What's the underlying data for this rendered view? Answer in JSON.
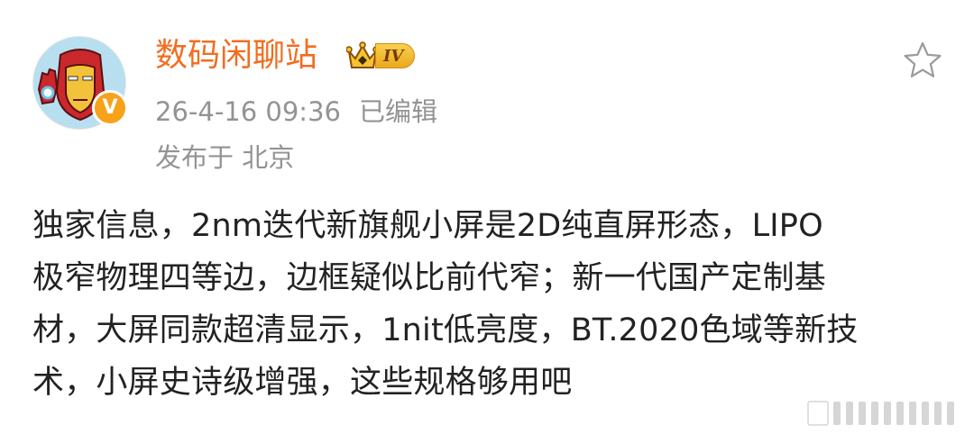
{
  "post": {
    "username": "数码闲聊站",
    "vip_level": "IV",
    "timestamp": "26-4-16 09:36",
    "edited_label": "已编辑",
    "location": "发布于 北京",
    "verified_mark": "V",
    "content_lines": [
      "独家信息，2nm迭代新旗舰小屏是2D纯直屏形态，LIPO",
      "极窄物理四等边，边框疑似比前代窄；新一代国产定制基",
      "材，大屏同款超清显示，1nit低亮度，BT.2020色域等新技",
      "术，小屏史诗级增强，这些规格够用吧"
    ]
  },
  "icons": {
    "avatar": "ironman-avatar",
    "verified": "verified-badge-icon",
    "vip": "crown-icon",
    "favorite": "star-outline-icon",
    "collapse": "collapse-bars-icon"
  },
  "colors": {
    "username": "#f26d21",
    "meta_text": "#939393",
    "body_text": "#222222",
    "verified_bg": "#f7a21b",
    "vip_gold": "#e9a91e"
  }
}
